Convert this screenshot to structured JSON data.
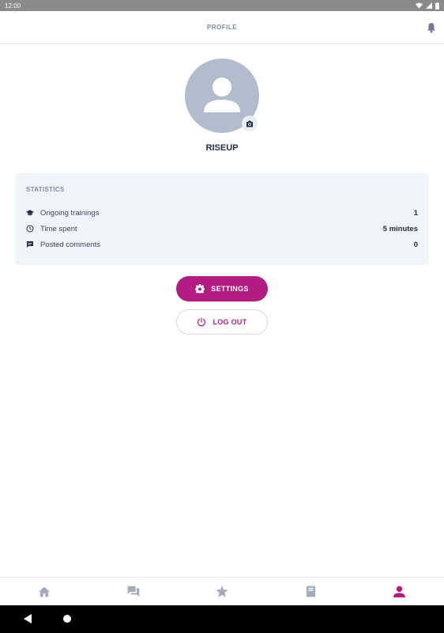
{
  "status_bar": {
    "time": "12:00"
  },
  "header": {
    "title": "PROFILE"
  },
  "profile": {
    "username": "RISEUP"
  },
  "statistics": {
    "title": "STATISTICS",
    "rows": [
      {
        "label": "Ongoing trainings",
        "value": "1",
        "icon": "graduation-cap-icon"
      },
      {
        "label": "Time spent",
        "value": "5 minutes",
        "icon": "clock-icon"
      },
      {
        "label": "Posted comments",
        "value": "0",
        "icon": "comment-icon"
      }
    ]
  },
  "buttons": {
    "settings": "SETTINGS",
    "logout": "LOG OUT"
  },
  "nav": {
    "items": [
      {
        "name": "home",
        "icon": "home-icon",
        "active": false
      },
      {
        "name": "forum",
        "icon": "chat-icon",
        "active": false
      },
      {
        "name": "favorites",
        "icon": "star-icon",
        "active": false
      },
      {
        "name": "catalog",
        "icon": "book-icon",
        "active": false
      },
      {
        "name": "profile",
        "icon": "person-icon",
        "active": true
      }
    ]
  },
  "colors": {
    "accent": "#b31d83",
    "avatar_bg": "#b3bccd",
    "nav_inactive": "#a3acbd",
    "card_bg": "#f1f5fa"
  }
}
